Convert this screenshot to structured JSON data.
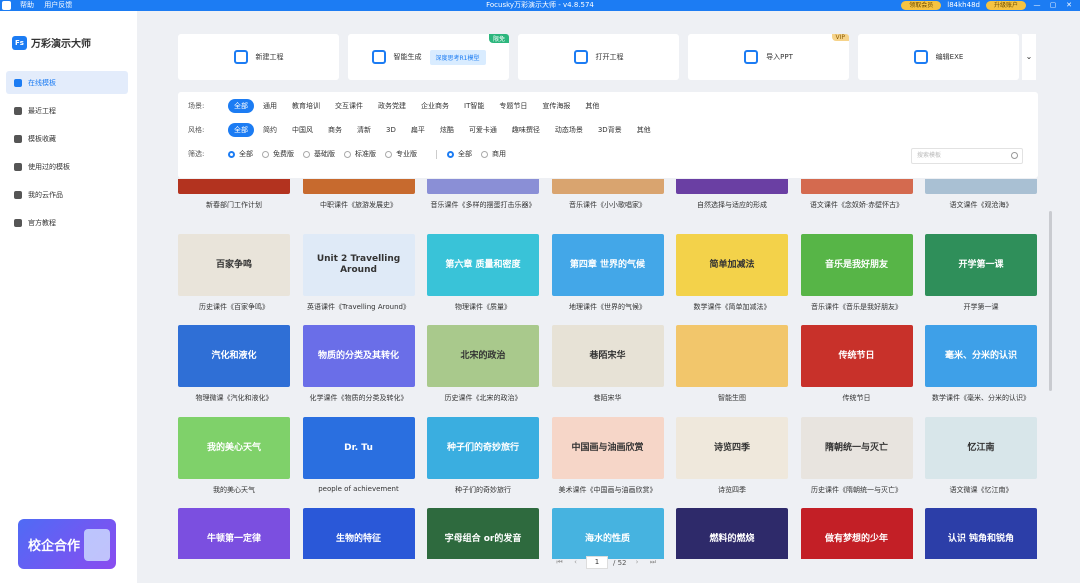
{
  "titlebar": {
    "title": "Focusky万彩演示大师 - v4.8.574",
    "menu": [
      "帮助",
      "用户反馈"
    ],
    "member": "领取会员",
    "user": "l84kh48d",
    "upgrade": "升级账户",
    "win": [
      "—",
      "▢",
      "✕"
    ]
  },
  "brand": {
    "logo": "Fs",
    "name": "万彩演示大师"
  },
  "sidebar": {
    "items": [
      {
        "label": "在线模板",
        "icon": "grid-icon",
        "active": true
      },
      {
        "label": "最近工程",
        "icon": "clock-icon"
      },
      {
        "label": "模板收藏",
        "icon": "star-icon"
      },
      {
        "label": "使用过的模板",
        "icon": "history-icon"
      },
      {
        "label": "我的云作品",
        "icon": "cloud-icon"
      },
      {
        "label": "官方教程",
        "icon": "info-icon"
      }
    ],
    "promo": "校企合作"
  },
  "actions": [
    {
      "label": "新建工程",
      "icon": "plus-icon"
    },
    {
      "label": "智能生成",
      "icon": "ai-icon",
      "extra": "深度思考R1模型",
      "tag": "限免"
    },
    {
      "label": "打开工程",
      "icon": "folder-icon"
    },
    {
      "label": "导入PPT",
      "icon": "ppt-icon",
      "tag": "VIP"
    },
    {
      "label": "编辑EXE",
      "icon": "exe-icon"
    }
  ],
  "filters": {
    "scene_label": "场景:",
    "scene": [
      "全部",
      "通用",
      "教育培训",
      "交互课件",
      "政务党建",
      "企业商务",
      "IT智能",
      "专题节日",
      "宣传海报",
      "其他"
    ],
    "style_label": "风格:",
    "style": [
      "全部",
      "简约",
      "中国风",
      "商务",
      "清新",
      "3D",
      "扁平",
      "炫酷",
      "可爱卡通",
      "趣味撰径",
      "动态场景",
      "3D背景",
      "其他"
    ],
    "screen_label": "筛选:",
    "screen1": [
      "全部",
      "免费版",
      "基础版",
      "标准版",
      "专业版"
    ],
    "screen2": [
      "全部",
      "商用"
    ],
    "search_placeholder": "搜索模板"
  },
  "rows": [
    {
      "labels": [
        "新春部门工作计划",
        "中职课件《旅游发展史》",
        "音乐课件《多样的摆蛋打击乐器》",
        "音乐课件《小小歌唱家》",
        "自然选择与适应的形成",
        "语文课件《念奴娇·赤壁怀古》",
        "语文课件《观沧海》"
      ],
      "thumbs": [
        "",
        "",
        "",
        "",
        "",
        "",
        ""
      ],
      "colors": [
        "#b3331f",
        "#c76a2e",
        "#8a8fd6",
        "#d9a46f",
        "#6a3fa3",
        "#d46a4f",
        "#a9c0d3"
      ]
    },
    {
      "labels": [
        "历史课件《百家争鸣》",
        "英语课件《Travelling Around》",
        "物理课件《质量》",
        "地理课件《世界的气候》",
        "数学课件《简单加减法》",
        "音乐课件《音乐是我好朋友》",
        "开学第一课"
      ],
      "thumbs": [
        "百家争鸣",
        "Unit 2 Travelling Around",
        "第六章 质量和密度",
        "第四章 世界的气候",
        "简单加减法",
        "音乐是我好朋友",
        "开学第一课"
      ],
      "colors": [
        "#e9e4da",
        "#dfeaf7",
        "#39c3d8",
        "#43a7e8",
        "#f3d24a",
        "#57b547",
        "#2f8f5a"
      ]
    },
    {
      "labels": [
        "物理微课《汽化和液化》",
        "化学课件《物质的分类及转化》",
        "历史课件《北宋的政治》",
        "巷陌宋华",
        "智能生图",
        "传统节日",
        "数学课件《毫米、分米的认识》"
      ],
      "thumbs": [
        "汽化和液化",
        "物质的分类及其转化",
        "北宋的政治",
        "巷陌宋华",
        "",
        "传统节日",
        "毫米、分米的认识"
      ],
      "colors": [
        "#2f6fd6",
        "#6a6ee8",
        "#a9c98c",
        "#e7e2d6",
        "#f2c66b",
        "#c8312a",
        "#3ea0e8"
      ]
    },
    {
      "labels": [
        "我的美心天气",
        "people of achievement",
        "种子们的奇妙旅行",
        "美术课件《中国画与油画欣赏》",
        "诗览四季",
        "历史课件《隋朝统一与灭亡》",
        "语文微课《忆江南》"
      ],
      "thumbs": [
        "我的美心天气",
        "Dr. Tu",
        "种子们的奇妙旅行",
        "中国画与油画欣赏",
        "诗览四季",
        "隋朝统一与灭亡",
        "忆江南"
      ],
      "colors": [
        "#7fd16a",
        "#2a6fe0",
        "#3aaee0",
        "#f6d6c8",
        "#efe8dc",
        "#e8e4df",
        "#d8e6ea"
      ]
    },
    {
      "labels": [
        "牛顿第一定律",
        "生物的特征",
        "字母组合or的发音",
        "海水的性质",
        "燃料的燃烧",
        "做有梦想的少年",
        "认识钝角和锐角"
      ],
      "thumbs": [
        "牛顿第一定律",
        "生物的特征",
        "字母组合 or的发音",
        "海水的性质",
        "燃料的燃烧",
        "做有梦想的少年",
        "认识 钝角和锐角"
      ],
      "colors": [
        "#7b4fe0",
        "#2a58d8",
        "#2e6a3e",
        "#46b3e0",
        "#2e2a6a",
        "#c31f26",
        "#2c3ea8"
      ]
    }
  ],
  "pager": {
    "current": "1",
    "total": "/ 52",
    "first": "⏮",
    "prev": "‹",
    "next": "›",
    "last": "⏭"
  }
}
